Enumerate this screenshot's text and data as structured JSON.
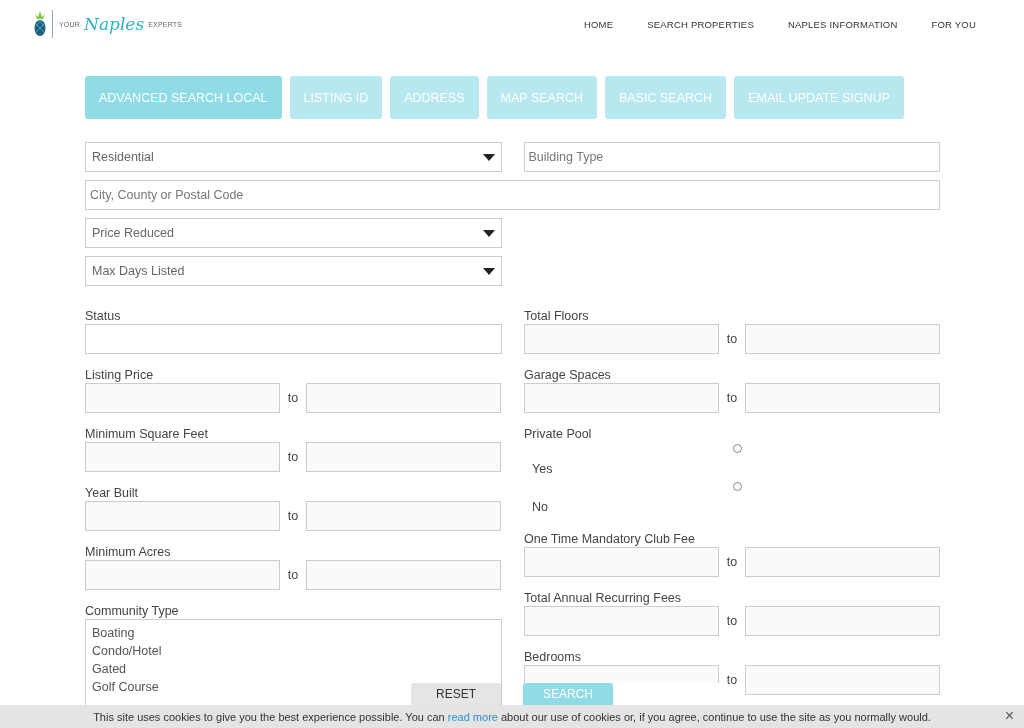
{
  "logo": {
    "words": [
      "YOUR",
      "Naples",
      "EXPERTS"
    ]
  },
  "nav": [
    "HOME",
    "SEARCH PROPERTIES",
    "NAPLES INFORMATION",
    "FOR YOU"
  ],
  "tabs": [
    {
      "label": "ADVANCED SEARCH LOCAL",
      "selected": true
    },
    {
      "label": "LISTING ID",
      "selected": false
    },
    {
      "label": "ADDRESS",
      "selected": false
    },
    {
      "label": "MAP SEARCH",
      "selected": false
    },
    {
      "label": "BASIC SEARCH",
      "selected": false
    },
    {
      "label": "EMAIL UPDATE SIGNUP",
      "selected": false
    }
  ],
  "property_type": {
    "value": "Residential"
  },
  "building_type": {
    "placeholder": "Building Type"
  },
  "location": {
    "placeholder": "City, County or Postal Code"
  },
  "price_reduced": {
    "value": "Price Reduced"
  },
  "max_days": {
    "value": "Max Days Listed"
  },
  "left_fields": [
    {
      "kind": "text",
      "label": "Status"
    },
    {
      "kind": "range",
      "label": "Listing Price",
      "to": "to"
    },
    {
      "kind": "range",
      "label": "Minimum Square Feet",
      "to": "to"
    },
    {
      "kind": "range",
      "label": "Year Built",
      "to": "to"
    },
    {
      "kind": "range",
      "label": "Minimum Acres",
      "to": "to"
    },
    {
      "kind": "list",
      "label": "Community Type",
      "options": [
        "Boating",
        "Condo/Hotel",
        "Gated",
        "Golf Course"
      ]
    }
  ],
  "right_fields": [
    {
      "kind": "range",
      "label": "Total Floors",
      "to": "to"
    },
    {
      "kind": "range",
      "label": "Garage Spaces",
      "to": "to"
    },
    {
      "kind": "radio",
      "label": "Private Pool",
      "options": [
        {
          "label": "Yes",
          "selected": false
        },
        {
          "label": "No",
          "selected": false
        }
      ]
    },
    {
      "kind": "range",
      "label": "One Time Mandatory Club Fee",
      "to": "to"
    },
    {
      "kind": "range",
      "label": "Total Annual Recurring Fees",
      "to": "to"
    },
    {
      "kind": "range",
      "label": "Bedrooms",
      "to": "to"
    }
  ],
  "buttons": {
    "reset": "RESET",
    "search": "SEARCH"
  },
  "cookie_bar": {
    "before": "This site uses cookies to give you the best experience possible. You can",
    "link": "read more",
    "after": "about our use of cookies or, if you agree, continue to use the site as you normally would.",
    "close": "×"
  }
}
